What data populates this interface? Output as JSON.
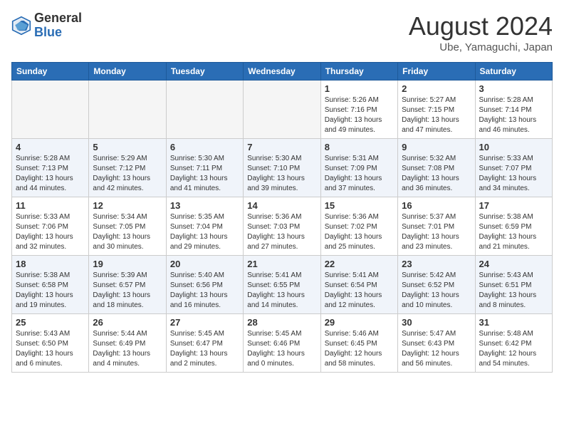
{
  "header": {
    "logo_general": "General",
    "logo_blue": "Blue",
    "month_title": "August 2024",
    "location": "Ube, Yamaguchi, Japan"
  },
  "weekdays": [
    "Sunday",
    "Monday",
    "Tuesday",
    "Wednesday",
    "Thursday",
    "Friday",
    "Saturday"
  ],
  "weeks": [
    [
      {
        "day": "",
        "info": ""
      },
      {
        "day": "",
        "info": ""
      },
      {
        "day": "",
        "info": ""
      },
      {
        "day": "",
        "info": ""
      },
      {
        "day": "1",
        "info": "Sunrise: 5:26 AM\nSunset: 7:16 PM\nDaylight: 13 hours\nand 49 minutes."
      },
      {
        "day": "2",
        "info": "Sunrise: 5:27 AM\nSunset: 7:15 PM\nDaylight: 13 hours\nand 47 minutes."
      },
      {
        "day": "3",
        "info": "Sunrise: 5:28 AM\nSunset: 7:14 PM\nDaylight: 13 hours\nand 46 minutes."
      }
    ],
    [
      {
        "day": "4",
        "info": "Sunrise: 5:28 AM\nSunset: 7:13 PM\nDaylight: 13 hours\nand 44 minutes."
      },
      {
        "day": "5",
        "info": "Sunrise: 5:29 AM\nSunset: 7:12 PM\nDaylight: 13 hours\nand 42 minutes."
      },
      {
        "day": "6",
        "info": "Sunrise: 5:30 AM\nSunset: 7:11 PM\nDaylight: 13 hours\nand 41 minutes."
      },
      {
        "day": "7",
        "info": "Sunrise: 5:30 AM\nSunset: 7:10 PM\nDaylight: 13 hours\nand 39 minutes."
      },
      {
        "day": "8",
        "info": "Sunrise: 5:31 AM\nSunset: 7:09 PM\nDaylight: 13 hours\nand 37 minutes."
      },
      {
        "day": "9",
        "info": "Sunrise: 5:32 AM\nSunset: 7:08 PM\nDaylight: 13 hours\nand 36 minutes."
      },
      {
        "day": "10",
        "info": "Sunrise: 5:33 AM\nSunset: 7:07 PM\nDaylight: 13 hours\nand 34 minutes."
      }
    ],
    [
      {
        "day": "11",
        "info": "Sunrise: 5:33 AM\nSunset: 7:06 PM\nDaylight: 13 hours\nand 32 minutes."
      },
      {
        "day": "12",
        "info": "Sunrise: 5:34 AM\nSunset: 7:05 PM\nDaylight: 13 hours\nand 30 minutes."
      },
      {
        "day": "13",
        "info": "Sunrise: 5:35 AM\nSunset: 7:04 PM\nDaylight: 13 hours\nand 29 minutes."
      },
      {
        "day": "14",
        "info": "Sunrise: 5:36 AM\nSunset: 7:03 PM\nDaylight: 13 hours\nand 27 minutes."
      },
      {
        "day": "15",
        "info": "Sunrise: 5:36 AM\nSunset: 7:02 PM\nDaylight: 13 hours\nand 25 minutes."
      },
      {
        "day": "16",
        "info": "Sunrise: 5:37 AM\nSunset: 7:01 PM\nDaylight: 13 hours\nand 23 minutes."
      },
      {
        "day": "17",
        "info": "Sunrise: 5:38 AM\nSunset: 6:59 PM\nDaylight: 13 hours\nand 21 minutes."
      }
    ],
    [
      {
        "day": "18",
        "info": "Sunrise: 5:38 AM\nSunset: 6:58 PM\nDaylight: 13 hours\nand 19 minutes."
      },
      {
        "day": "19",
        "info": "Sunrise: 5:39 AM\nSunset: 6:57 PM\nDaylight: 13 hours\nand 18 minutes."
      },
      {
        "day": "20",
        "info": "Sunrise: 5:40 AM\nSunset: 6:56 PM\nDaylight: 13 hours\nand 16 minutes."
      },
      {
        "day": "21",
        "info": "Sunrise: 5:41 AM\nSunset: 6:55 PM\nDaylight: 13 hours\nand 14 minutes."
      },
      {
        "day": "22",
        "info": "Sunrise: 5:41 AM\nSunset: 6:54 PM\nDaylight: 13 hours\nand 12 minutes."
      },
      {
        "day": "23",
        "info": "Sunrise: 5:42 AM\nSunset: 6:52 PM\nDaylight: 13 hours\nand 10 minutes."
      },
      {
        "day": "24",
        "info": "Sunrise: 5:43 AM\nSunset: 6:51 PM\nDaylight: 13 hours\nand 8 minutes."
      }
    ],
    [
      {
        "day": "25",
        "info": "Sunrise: 5:43 AM\nSunset: 6:50 PM\nDaylight: 13 hours\nand 6 minutes."
      },
      {
        "day": "26",
        "info": "Sunrise: 5:44 AM\nSunset: 6:49 PM\nDaylight: 13 hours\nand 4 minutes."
      },
      {
        "day": "27",
        "info": "Sunrise: 5:45 AM\nSunset: 6:47 PM\nDaylight: 13 hours\nand 2 minutes."
      },
      {
        "day": "28",
        "info": "Sunrise: 5:45 AM\nSunset: 6:46 PM\nDaylight: 13 hours\nand 0 minutes."
      },
      {
        "day": "29",
        "info": "Sunrise: 5:46 AM\nSunset: 6:45 PM\nDaylight: 12 hours\nand 58 minutes."
      },
      {
        "day": "30",
        "info": "Sunrise: 5:47 AM\nSunset: 6:43 PM\nDaylight: 12 hours\nand 56 minutes."
      },
      {
        "day": "31",
        "info": "Sunrise: 5:48 AM\nSunset: 6:42 PM\nDaylight: 12 hours\nand 54 minutes."
      }
    ]
  ]
}
